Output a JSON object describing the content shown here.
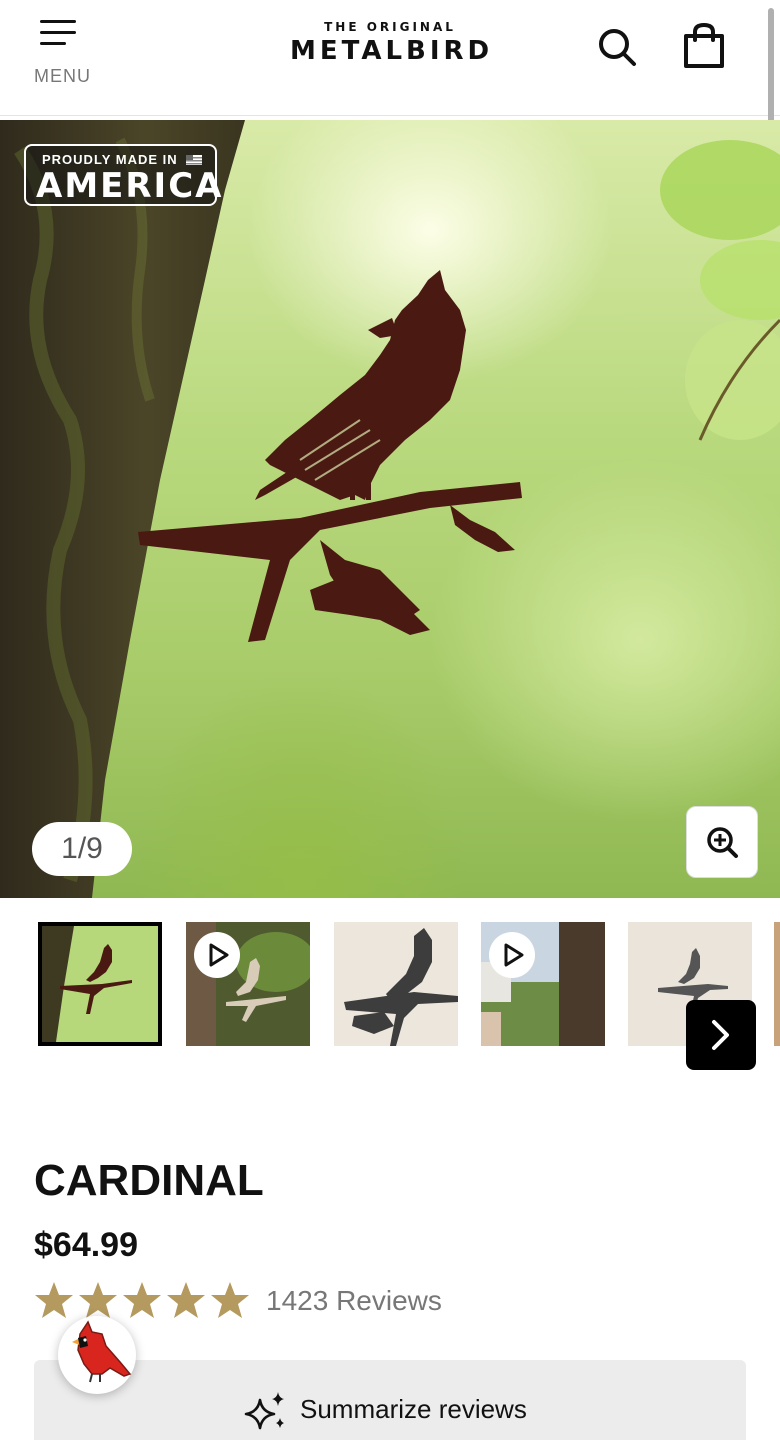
{
  "header": {
    "menu_label": "MENU",
    "logo_small": "THE ORIGINAL",
    "logo_big": "METALBIRD",
    "icons": [
      "menu-icon",
      "search-icon",
      "shopping-bag-icon"
    ]
  },
  "gallery": {
    "badge_line1": "PROUDLY MADE IN",
    "badge_line2": "AMERICA",
    "counter": "1/9",
    "current_index": 1,
    "total_images": 9,
    "zoom_icon": "zoom-in-icon",
    "thumbnails": [
      {
        "kind": "image",
        "active": true
      },
      {
        "kind": "video",
        "active": false
      },
      {
        "kind": "image",
        "active": false
      },
      {
        "kind": "video",
        "active": false
      },
      {
        "kind": "image",
        "active": false
      }
    ],
    "next_icon": "chevron-right-icon"
  },
  "product": {
    "title": "CARDINAL",
    "price": "$64.99",
    "rating": 5,
    "reviews_label": "1423 Reviews",
    "summarize_label": "Summarize reviews",
    "summarize_icon": "sparkles-icon"
  },
  "colors": {
    "star": "#b49a5e",
    "accent": "#000000",
    "button_bg": "#ececec"
  }
}
